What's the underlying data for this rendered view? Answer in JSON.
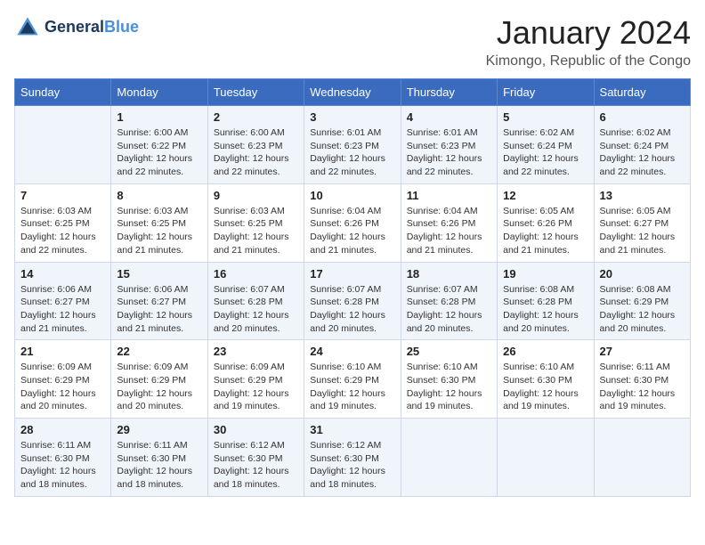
{
  "header": {
    "logo_line1": "General",
    "logo_line2": "Blue",
    "month_year": "January 2024",
    "location": "Kimongo, Republic of the Congo"
  },
  "days_of_week": [
    "Sunday",
    "Monday",
    "Tuesday",
    "Wednesday",
    "Thursday",
    "Friday",
    "Saturday"
  ],
  "weeks": [
    [
      {
        "day": "",
        "sunrise": "",
        "sunset": "",
        "daylight": ""
      },
      {
        "day": "1",
        "sunrise": "Sunrise: 6:00 AM",
        "sunset": "Sunset: 6:22 PM",
        "daylight": "Daylight: 12 hours and 22 minutes."
      },
      {
        "day": "2",
        "sunrise": "Sunrise: 6:00 AM",
        "sunset": "Sunset: 6:23 PM",
        "daylight": "Daylight: 12 hours and 22 minutes."
      },
      {
        "day": "3",
        "sunrise": "Sunrise: 6:01 AM",
        "sunset": "Sunset: 6:23 PM",
        "daylight": "Daylight: 12 hours and 22 minutes."
      },
      {
        "day": "4",
        "sunrise": "Sunrise: 6:01 AM",
        "sunset": "Sunset: 6:23 PM",
        "daylight": "Daylight: 12 hours and 22 minutes."
      },
      {
        "day": "5",
        "sunrise": "Sunrise: 6:02 AM",
        "sunset": "Sunset: 6:24 PM",
        "daylight": "Daylight: 12 hours and 22 minutes."
      },
      {
        "day": "6",
        "sunrise": "Sunrise: 6:02 AM",
        "sunset": "Sunset: 6:24 PM",
        "daylight": "Daylight: 12 hours and 22 minutes."
      }
    ],
    [
      {
        "day": "7",
        "sunrise": "Sunrise: 6:03 AM",
        "sunset": "Sunset: 6:25 PM",
        "daylight": "Daylight: 12 hours and 22 minutes."
      },
      {
        "day": "8",
        "sunrise": "Sunrise: 6:03 AM",
        "sunset": "Sunset: 6:25 PM",
        "daylight": "Daylight: 12 hours and 21 minutes."
      },
      {
        "day": "9",
        "sunrise": "Sunrise: 6:03 AM",
        "sunset": "Sunset: 6:25 PM",
        "daylight": "Daylight: 12 hours and 21 minutes."
      },
      {
        "day": "10",
        "sunrise": "Sunrise: 6:04 AM",
        "sunset": "Sunset: 6:26 PM",
        "daylight": "Daylight: 12 hours and 21 minutes."
      },
      {
        "day": "11",
        "sunrise": "Sunrise: 6:04 AM",
        "sunset": "Sunset: 6:26 PM",
        "daylight": "Daylight: 12 hours and 21 minutes."
      },
      {
        "day": "12",
        "sunrise": "Sunrise: 6:05 AM",
        "sunset": "Sunset: 6:26 PM",
        "daylight": "Daylight: 12 hours and 21 minutes."
      },
      {
        "day": "13",
        "sunrise": "Sunrise: 6:05 AM",
        "sunset": "Sunset: 6:27 PM",
        "daylight": "Daylight: 12 hours and 21 minutes."
      }
    ],
    [
      {
        "day": "14",
        "sunrise": "Sunrise: 6:06 AM",
        "sunset": "Sunset: 6:27 PM",
        "daylight": "Daylight: 12 hours and 21 minutes."
      },
      {
        "day": "15",
        "sunrise": "Sunrise: 6:06 AM",
        "sunset": "Sunset: 6:27 PM",
        "daylight": "Daylight: 12 hours and 21 minutes."
      },
      {
        "day": "16",
        "sunrise": "Sunrise: 6:07 AM",
        "sunset": "Sunset: 6:28 PM",
        "daylight": "Daylight: 12 hours and 20 minutes."
      },
      {
        "day": "17",
        "sunrise": "Sunrise: 6:07 AM",
        "sunset": "Sunset: 6:28 PM",
        "daylight": "Daylight: 12 hours and 20 minutes."
      },
      {
        "day": "18",
        "sunrise": "Sunrise: 6:07 AM",
        "sunset": "Sunset: 6:28 PM",
        "daylight": "Daylight: 12 hours and 20 minutes."
      },
      {
        "day": "19",
        "sunrise": "Sunrise: 6:08 AM",
        "sunset": "Sunset: 6:28 PM",
        "daylight": "Daylight: 12 hours and 20 minutes."
      },
      {
        "day": "20",
        "sunrise": "Sunrise: 6:08 AM",
        "sunset": "Sunset: 6:29 PM",
        "daylight": "Daylight: 12 hours and 20 minutes."
      }
    ],
    [
      {
        "day": "21",
        "sunrise": "Sunrise: 6:09 AM",
        "sunset": "Sunset: 6:29 PM",
        "daylight": "Daylight: 12 hours and 20 minutes."
      },
      {
        "day": "22",
        "sunrise": "Sunrise: 6:09 AM",
        "sunset": "Sunset: 6:29 PM",
        "daylight": "Daylight: 12 hours and 20 minutes."
      },
      {
        "day": "23",
        "sunrise": "Sunrise: 6:09 AM",
        "sunset": "Sunset: 6:29 PM",
        "daylight": "Daylight: 12 hours and 19 minutes."
      },
      {
        "day": "24",
        "sunrise": "Sunrise: 6:10 AM",
        "sunset": "Sunset: 6:29 PM",
        "daylight": "Daylight: 12 hours and 19 minutes."
      },
      {
        "day": "25",
        "sunrise": "Sunrise: 6:10 AM",
        "sunset": "Sunset: 6:30 PM",
        "daylight": "Daylight: 12 hours and 19 minutes."
      },
      {
        "day": "26",
        "sunrise": "Sunrise: 6:10 AM",
        "sunset": "Sunset: 6:30 PM",
        "daylight": "Daylight: 12 hours and 19 minutes."
      },
      {
        "day": "27",
        "sunrise": "Sunrise: 6:11 AM",
        "sunset": "Sunset: 6:30 PM",
        "daylight": "Daylight: 12 hours and 19 minutes."
      }
    ],
    [
      {
        "day": "28",
        "sunrise": "Sunrise: 6:11 AM",
        "sunset": "Sunset: 6:30 PM",
        "daylight": "Daylight: 12 hours and 18 minutes."
      },
      {
        "day": "29",
        "sunrise": "Sunrise: 6:11 AM",
        "sunset": "Sunset: 6:30 PM",
        "daylight": "Daylight: 12 hours and 18 minutes."
      },
      {
        "day": "30",
        "sunrise": "Sunrise: 6:12 AM",
        "sunset": "Sunset: 6:30 PM",
        "daylight": "Daylight: 12 hours and 18 minutes."
      },
      {
        "day": "31",
        "sunrise": "Sunrise: 6:12 AM",
        "sunset": "Sunset: 6:30 PM",
        "daylight": "Daylight: 12 hours and 18 minutes."
      },
      {
        "day": "",
        "sunrise": "",
        "sunset": "",
        "daylight": ""
      },
      {
        "day": "",
        "sunrise": "",
        "sunset": "",
        "daylight": ""
      },
      {
        "day": "",
        "sunrise": "",
        "sunset": "",
        "daylight": ""
      }
    ]
  ]
}
